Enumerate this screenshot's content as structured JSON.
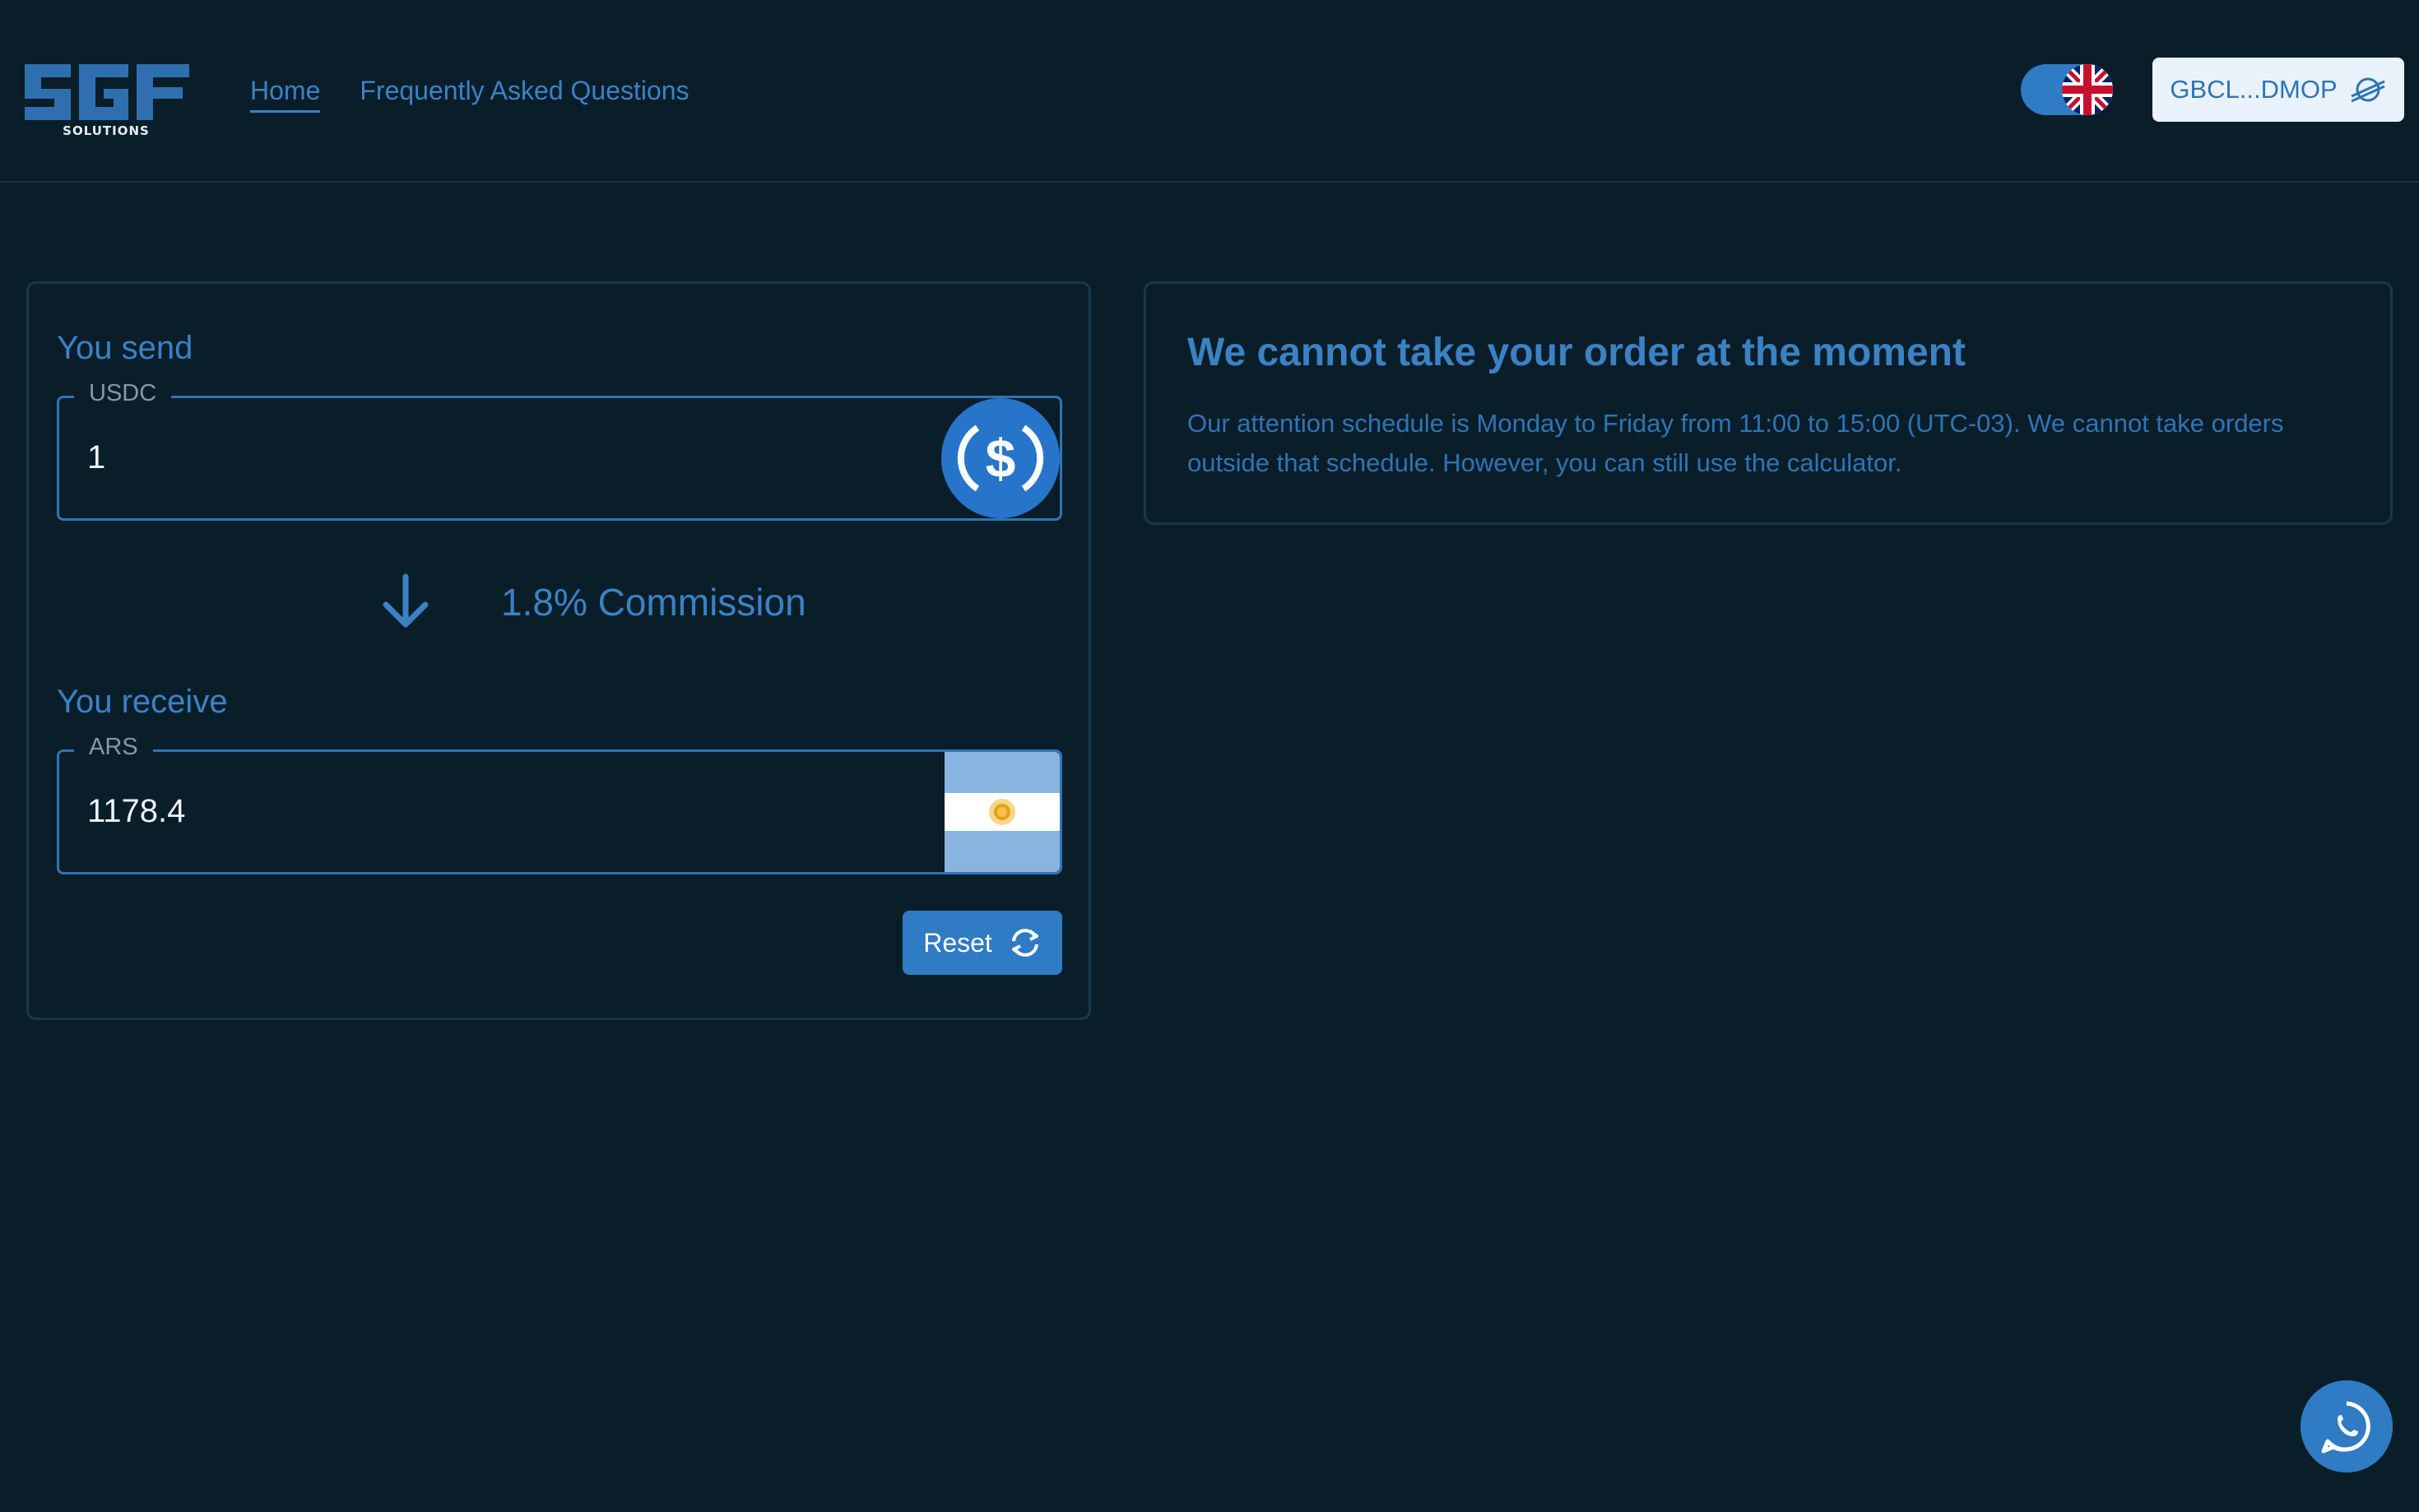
{
  "header": {
    "logo_subtitle": "SOLUTIONS",
    "nav": [
      {
        "label": "Home",
        "active": true
      },
      {
        "label": "Frequently Asked Questions",
        "active": false
      }
    ],
    "language_flag_icon": "uk-flag-icon",
    "wallet_label": "GBCL...DMOP",
    "wallet_icon": "stellar-icon"
  },
  "calculator": {
    "send_label": "You send",
    "send_currency": "USDC",
    "send_value": "1",
    "send_icon": "usdc-icon",
    "commission_text": "1.8% Commission",
    "receive_label": "You receive",
    "receive_currency": "ARS",
    "receive_value": "1178.4",
    "receive_icon": "argentina-flag-icon",
    "reset_label": "Reset"
  },
  "notice": {
    "title": "We cannot take your order at the moment",
    "body": "Our attention schedule is Monday to Friday from 11:00 to 15:00 (UTC-03). We cannot take orders outside that schedule. However, you can still use the calculator."
  },
  "colors": {
    "background": "#0a1e2a",
    "accent": "#3b82c4",
    "border": "#16384e"
  }
}
